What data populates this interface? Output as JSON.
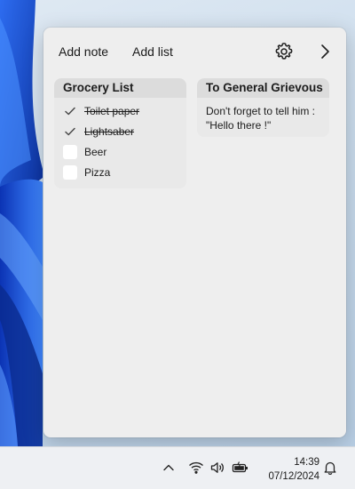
{
  "toolbar": {
    "add_note_label": "Add note",
    "add_list_label": "Add list",
    "settings_icon": "gear-icon",
    "collapse_icon": "chevron-right-icon"
  },
  "lists": [
    {
      "title": "Grocery List",
      "items": [
        {
          "label": "Toilet paper",
          "checked": true
        },
        {
          "label": "Lightsaber",
          "checked": true
        },
        {
          "label": "Beer",
          "checked": false
        },
        {
          "label": "Pizza",
          "checked": false
        }
      ]
    }
  ],
  "notes": [
    {
      "title": "To General Grievous",
      "body": "Don't forget to tell him :\n\"Hello there !\""
    }
  ],
  "taskbar": {
    "time": "14:39",
    "date": "07/12/2024",
    "icons": [
      "chevron-up-icon",
      "wifi-icon",
      "volume-icon",
      "battery-icon",
      "bell-icon"
    ]
  },
  "colors": {
    "panel_bg": "#eeeeee",
    "card_bg": "#e9e9e9",
    "card_header_bg": "#dcdcdc",
    "wallpaper_accent": "#1a4fd6"
  }
}
